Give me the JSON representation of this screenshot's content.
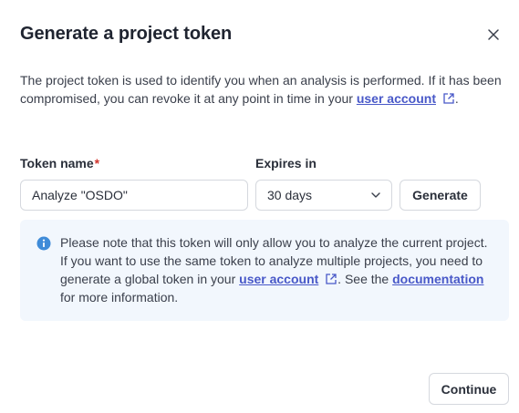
{
  "dialog": {
    "title": "Generate a project token",
    "description_before": "The project token is used to identify you when an analysis is performed. If it has been compromised, you can revoke it at any point in time in your ",
    "description_link": "user account",
    "description_after": "."
  },
  "form": {
    "token_name_label": "Token name",
    "required_marker": "*",
    "token_name_value": "Analyze \"OSDO\"",
    "expires_label": "Expires in",
    "expires_value": "30 days",
    "generate_label": "Generate"
  },
  "note": {
    "text_before": "Please note that this token will only allow you to analyze the current project. If you want to use the same token to analyze multiple projects, you need to generate a global token in your ",
    "user_account_link": "user account",
    "text_middle": ". See the ",
    "documentation_link": "documentation",
    "text_after": " for more information."
  },
  "footer": {
    "continue_label": "Continue"
  },
  "colors": {
    "link": "#4858c8",
    "required": "#d0342c",
    "note_background": "#f2f7fd",
    "info_icon": "#3f8bd8"
  }
}
